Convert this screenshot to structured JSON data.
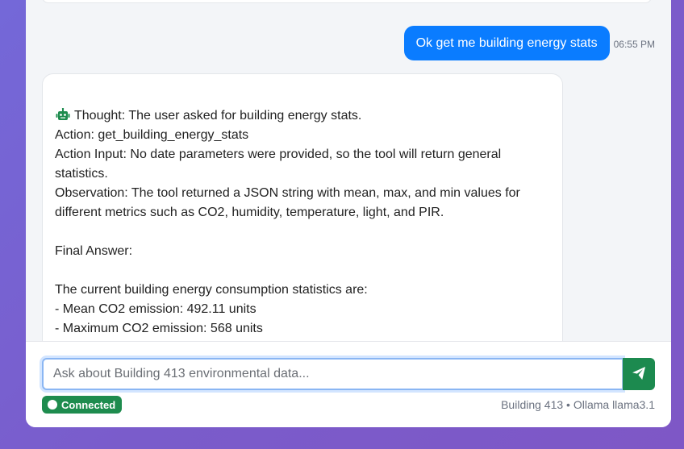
{
  "chat": {
    "user_message": "Ok get me building energy stats",
    "user_time": "06:55 PM",
    "bot_lines": [
      "Thought: The user asked for building energy stats.",
      "Action: get_building_energy_stats",
      "Action Input: No date parameters were provided, so the tool will return general",
      "statistics.",
      "Observation: The tool returned a JSON string with mean, max, and min values for",
      "different metrics such as CO2, humidity, temperature, light, and PIR.",
      "",
      "Final Answer:",
      "",
      "The current building energy consumption statistics are:",
      "- Mean CO2 emission: 492.11 units",
      "- Maximum CO2 emission: 568 units"
    ],
    "bot_icon": "robot-icon"
  },
  "input": {
    "placeholder": "Ask about Building 413 environmental data...",
    "value": "",
    "send_icon": "send-icon"
  },
  "status": {
    "label": "Connected",
    "color": "#1e8c4e"
  },
  "footer": {
    "info": "Building 413 • Ollama llama3.1"
  },
  "colors": {
    "user_bubble": "#0a7cff",
    "accent_green": "#1c8a4f"
  }
}
